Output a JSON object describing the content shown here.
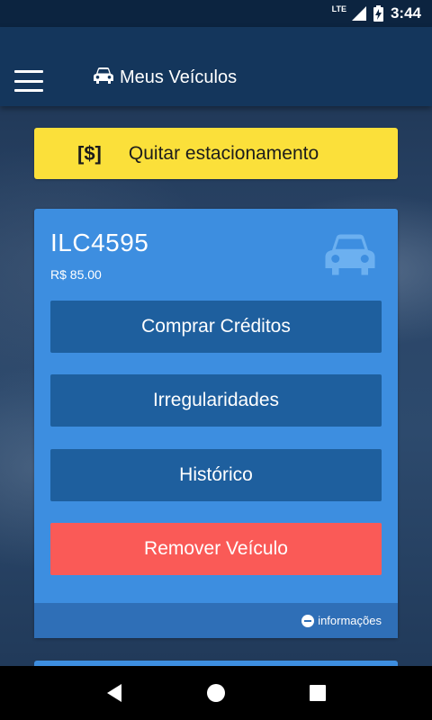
{
  "status_bar": {
    "network_label": "LTE",
    "time": "3:44"
  },
  "app_bar": {
    "title": "Meus Veículos"
  },
  "pay_button": {
    "icon_text": "[$]",
    "label": "Quitar estacionamento"
  },
  "vehicle": {
    "plate": "ILC4595",
    "balance": "R$ 85.00",
    "buttons": {
      "buy_credits": "Comprar Créditos",
      "irregularities": "Irregularidades",
      "history": "Histórico",
      "remove": "Remover Veículo"
    },
    "footer_link": "informações"
  },
  "colors": {
    "app_bar": "#14365c",
    "pay_button": "#fbe03a",
    "card": "#3d8ee0",
    "action_button": "#1e5f9e",
    "remove_button": "#fa5a57"
  },
  "icons": {
    "menu": "hamburger-icon",
    "title": "car-icon",
    "card": "car-icon",
    "footer": "minus-circle-icon",
    "nav": [
      "back-icon",
      "home-icon",
      "recents-icon"
    ]
  }
}
